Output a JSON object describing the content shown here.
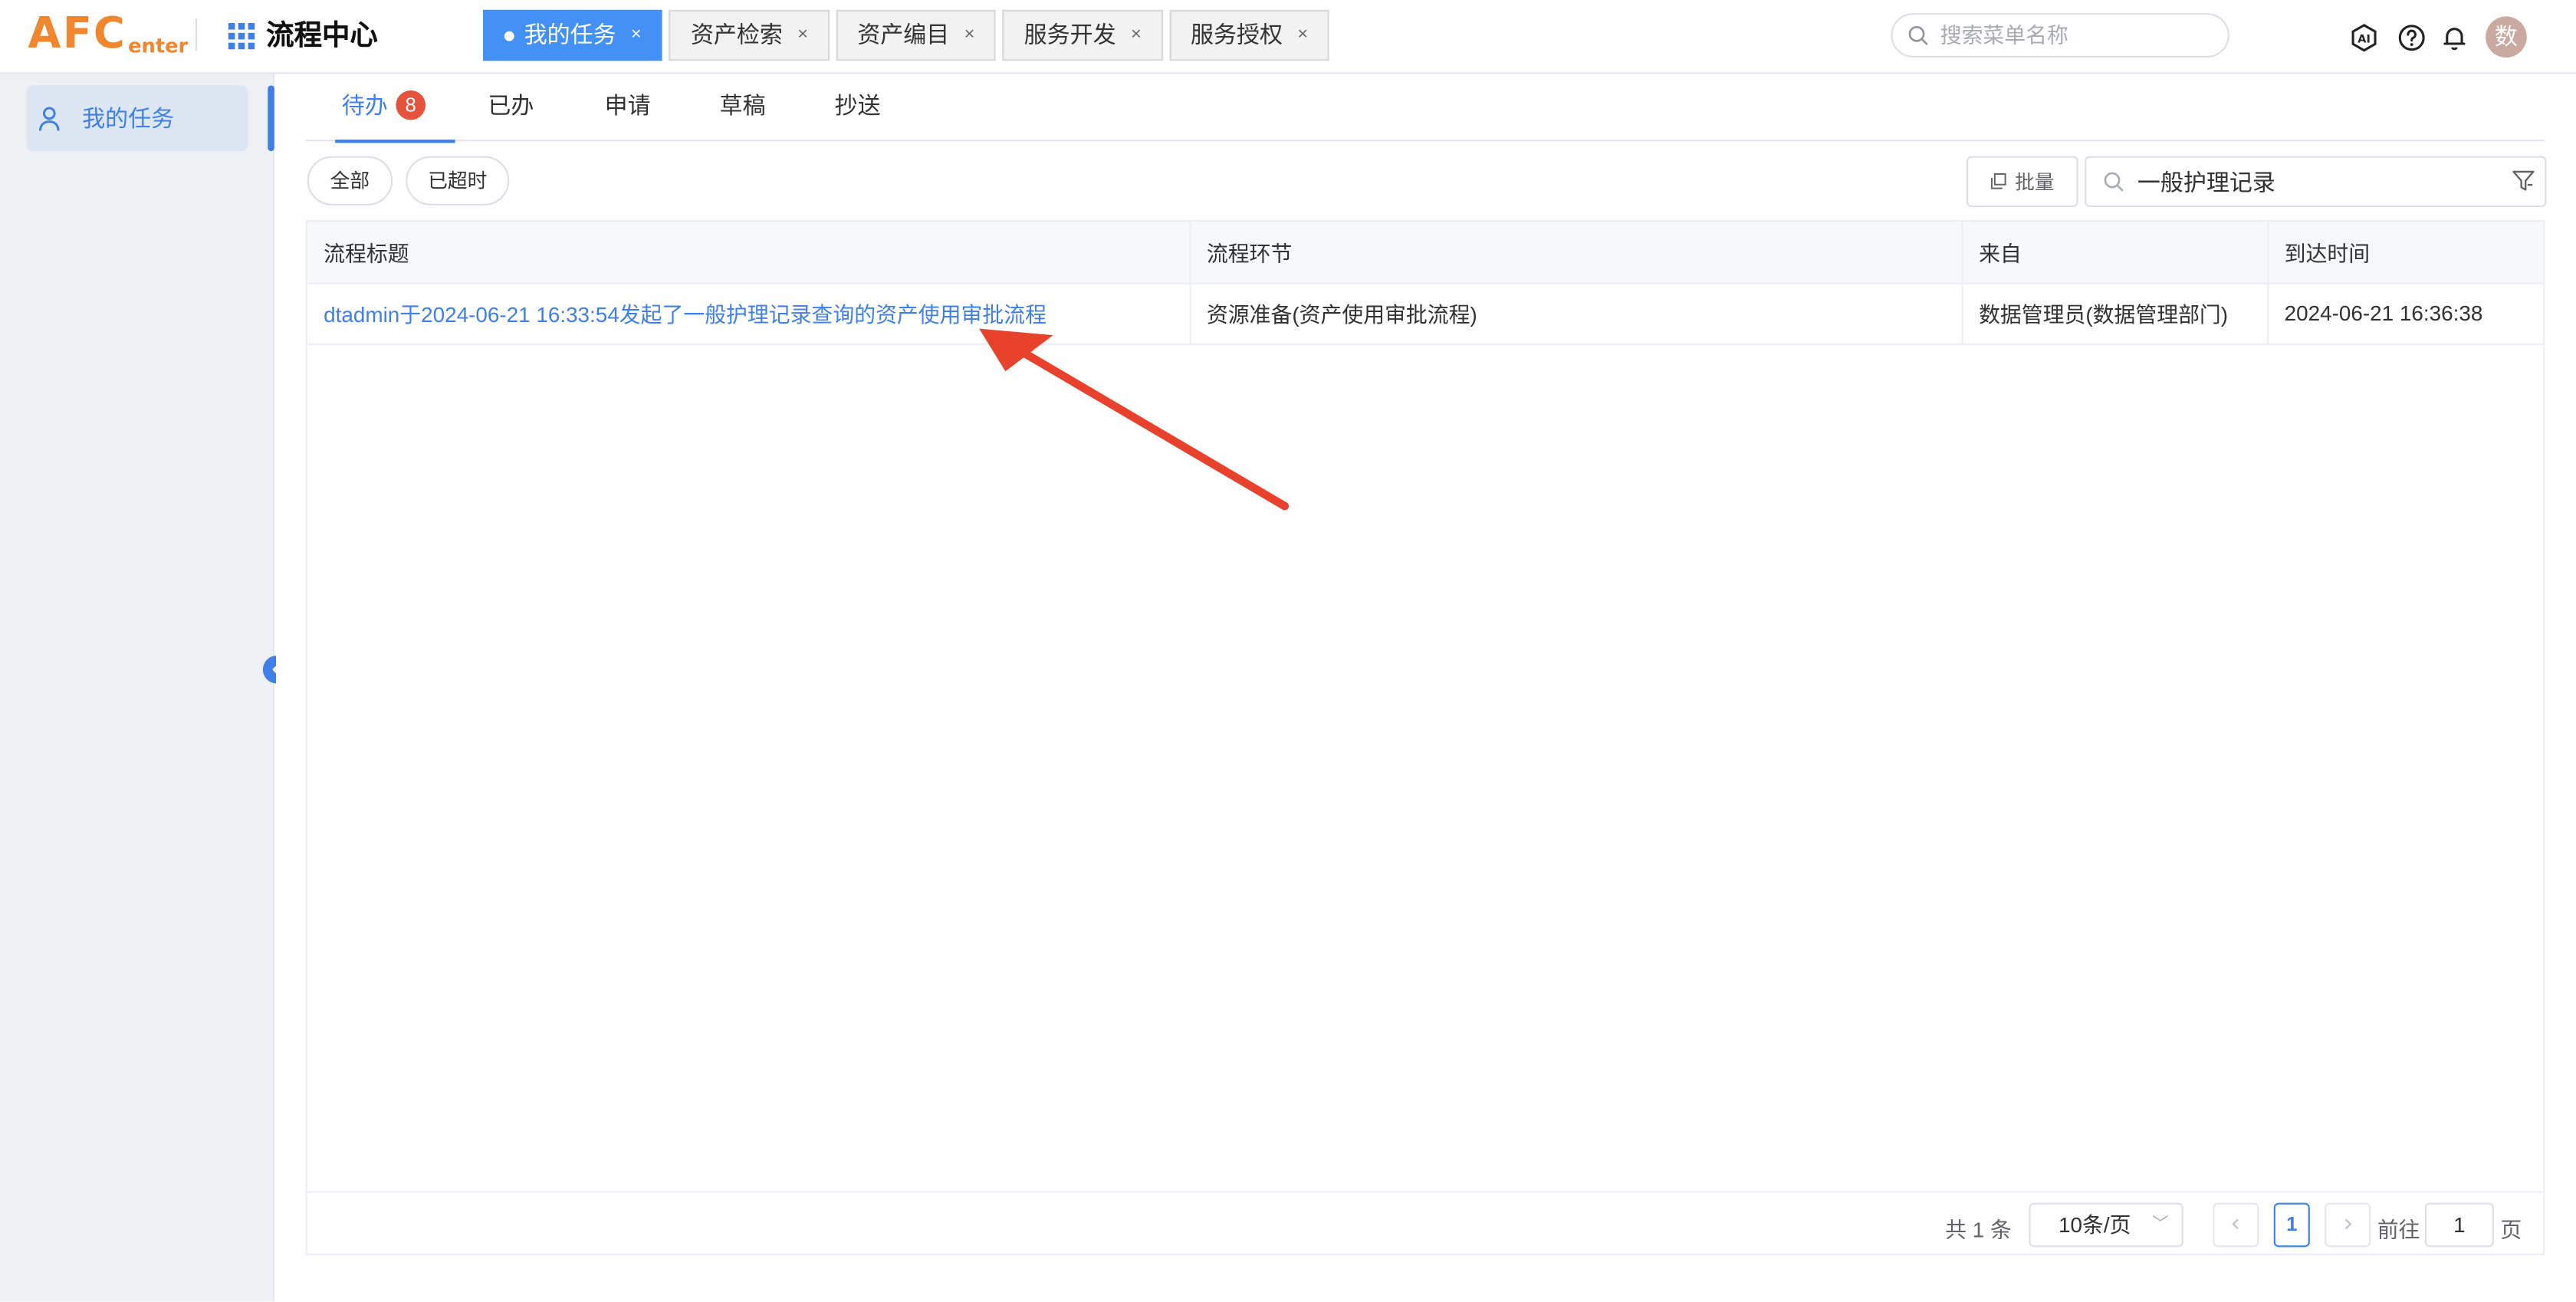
{
  "header": {
    "logo_big": "AFC",
    "logo_small": "enter",
    "app_title": "流程中心",
    "tabs": [
      {
        "label": "我的任务",
        "active": true
      },
      {
        "label": "资产检索",
        "active": false
      },
      {
        "label": "资产编目",
        "active": false
      },
      {
        "label": "服务开发",
        "active": false
      },
      {
        "label": "服务授权",
        "active": false
      }
    ],
    "tab_close_glyph": "×",
    "search_placeholder": "搜索菜单名称",
    "icons": [
      "ai-assistant-icon",
      "help-icon",
      "bell-icon"
    ],
    "avatar_text": "数"
  },
  "sidebar": {
    "items": [
      {
        "label": "我的任务",
        "icon": "user-icon",
        "active": true
      }
    ]
  },
  "main": {
    "tabs": [
      {
        "label": "待办",
        "badge": "8",
        "active": true
      },
      {
        "label": "已办"
      },
      {
        "label": "申请"
      },
      {
        "label": "草稿"
      },
      {
        "label": "抄送"
      }
    ],
    "filters": {
      "all": "全部",
      "overtime": "已超时"
    },
    "batch_label": "批量",
    "search_value": "一般护理记录",
    "table": {
      "columns": [
        "流程标题",
        "流程环节",
        "来自",
        "到达时间"
      ],
      "rows": [
        {
          "title": "dtadmin于2024-06-21 16:33:54发起了一般护理记录查询的资产使用审批流程",
          "step": "资源准备(资产使用审批流程)",
          "from": "数据管理员(数据管理部门)",
          "arrival": "2024-06-21 16:36:38"
        }
      ]
    },
    "pagination": {
      "total_text": "共 1 条",
      "page_size": "10条/页",
      "current_page": "1",
      "goto_label": "前往",
      "goto_value": "1",
      "page_unit": "页"
    }
  },
  "colors": {
    "accent": "#3f7fe8",
    "brand": "#f0862d",
    "badge": "#e5533c",
    "annotation_arrow": "#e8412c"
  }
}
